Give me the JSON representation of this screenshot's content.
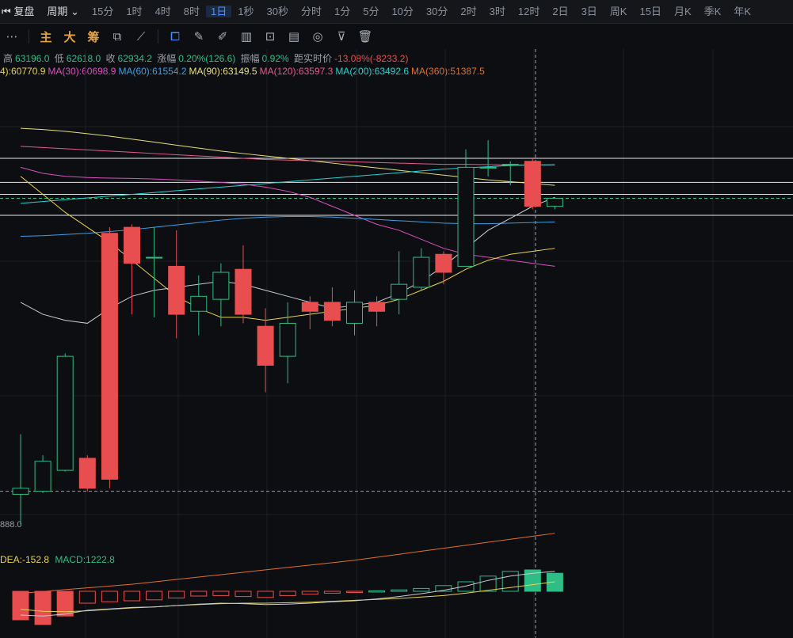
{
  "topbar": {
    "fq_label": "复盘",
    "zq_label": "周期",
    "periods": [
      "15分",
      "1时",
      "4时",
      "8时",
      "1日",
      "1秒",
      "30秒",
      "分时",
      "1分",
      "5分",
      "10分",
      "30分",
      "2时",
      "3时",
      "12时",
      "2日",
      "3日",
      "周K",
      "15日",
      "月K",
      "季K",
      "年K"
    ],
    "active_period": "1日"
  },
  "toolbar": {
    "indicators": [
      "主",
      "大",
      "筹"
    ]
  },
  "ohlc": {
    "high_label": "高",
    "high": "63196.0",
    "low_label": "低",
    "low": "62618.0",
    "close_label": "收",
    "close": "62934.2",
    "change_label": "涨幅",
    "change": "0.20%(126.6)",
    "amp_label": "振幅",
    "amp": "0.92%",
    "dist_label": "距实时价",
    "dist": "-13.08%(-8233.2)"
  },
  "ma": [
    {
      "text": "4):60770.9",
      "color": "#e8d44d"
    },
    {
      "text": "MA(30):60698.9",
      "color": "#d94fc0"
    },
    {
      "text": "MA(60):61554.2",
      "color": "#3aa0e8"
    },
    {
      "text": "MA(90):63149.5",
      "color": "#e8e07a"
    },
    {
      "text": "MA(120):63597.3",
      "color": "#e35d88"
    },
    {
      "text": "MA(200):63492.6",
      "color": "#27d1d1"
    },
    {
      "text": "MA(360):51387.5",
      "color": "#e0702a"
    }
  ],
  "macd": {
    "dea": "DEA:-152.8",
    "dea_color": "#e8d44d",
    "macd": "MACD:1222.8",
    "macd_color": "#2dbd85"
  },
  "price_label": "888.0",
  "colors": {
    "up": "#2dbd85",
    "down": "#e84e4f",
    "grid": "#1c1f24"
  },
  "chart_data": {
    "type": "candlestick",
    "candles": [
      {
        "o": 58000,
        "h": 59000,
        "l": 57500,
        "c": 58100
      },
      {
        "o": 58050,
        "h": 58650,
        "l": 58020,
        "c": 58550
      },
      {
        "o": 58400,
        "h": 60350,
        "l": 58380,
        "c": 60300
      },
      {
        "o": 58600,
        "h": 58650,
        "l": 58050,
        "c": 58100
      },
      {
        "o": 62350,
        "h": 62450,
        "l": 58100,
        "c": 58250
      },
      {
        "o": 62450,
        "h": 62500,
        "l": 61000,
        "c": 61850
      },
      {
        "o": 61950,
        "h": 62450,
        "l": 60950,
        "c": 61950
      },
      {
        "o": 61800,
        "h": 62400,
        "l": 60600,
        "c": 61000
      },
      {
        "o": 61050,
        "h": 61650,
        "l": 60650,
        "c": 61300
      },
      {
        "o": 61250,
        "h": 61850,
        "l": 60800,
        "c": 61700
      },
      {
        "o": 61750,
        "h": 62150,
        "l": 60850,
        "c": 61000
      },
      {
        "o": 60800,
        "h": 61100,
        "l": 59700,
        "c": 60150
      },
      {
        "o": 60300,
        "h": 61200,
        "l": 59850,
        "c": 60850
      },
      {
        "o": 61200,
        "h": 61300,
        "l": 60750,
        "c": 61050
      },
      {
        "o": 61200,
        "h": 61450,
        "l": 60800,
        "c": 60900
      },
      {
        "o": 60850,
        "h": 61400,
        "l": 60650,
        "c": 61200
      },
      {
        "o": 61200,
        "h": 61300,
        "l": 60800,
        "c": 61050
      },
      {
        "o": 61250,
        "h": 62050,
        "l": 61000,
        "c": 61500
      },
      {
        "o": 61450,
        "h": 62100,
        "l": 61400,
        "c": 61950
      },
      {
        "o": 62000,
        "h": 62050,
        "l": 61500,
        "c": 61700
      },
      {
        "o": 61800,
        "h": 63750,
        "l": 61800,
        "c": 63450
      },
      {
        "o": 63450,
        "h": 63900,
        "l": 63300,
        "c": 63450
      },
      {
        "o": 63500,
        "h": 63550,
        "l": 63150,
        "c": 63500
      },
      {
        "o": 63550,
        "h": 63600,
        "l": 62750,
        "c": 62800
      },
      {
        "o": 62800,
        "h": 62850,
        "l": 62750,
        "c": 62934.2
      }
    ],
    "ma_lines": [
      {
        "name": "MA(30)",
        "color": "#d94fc0",
        "values": [
          63450,
          63350,
          63300,
          63280,
          63270,
          63265,
          63255,
          63240,
          63220,
          63200,
          63170,
          63120,
          63050,
          62950,
          62800,
          62650,
          62500,
          62400,
          62250,
          62100,
          62000,
          61950,
          61900,
          61850,
          61800
        ]
      },
      {
        "name": "MA(60)",
        "color": "#3aa0e8",
        "values": [
          62300,
          62310,
          62330,
          62350,
          62380,
          62410,
          62450,
          62490,
          62530,
          62570,
          62600,
          62620,
          62630,
          62630,
          62620,
          62600,
          62580,
          62560,
          62540,
          62520,
          62510,
          62510,
          62520,
          62530,
          62540
        ]
      },
      {
        "name": "MA(90)",
        "color": "#e8e07a",
        "values": [
          64100,
          64080,
          64050,
          64010,
          63970,
          63920,
          63870,
          63820,
          63770,
          63720,
          63680,
          63640,
          63600,
          63560,
          63520,
          63480,
          63440,
          63400,
          63360,
          63320,
          63280,
          63240,
          63210,
          63180,
          63149.5
        ]
      },
      {
        "name": "MA(120)",
        "color": "#e35d88",
        "values": [
          63800,
          63780,
          63760,
          63740,
          63720,
          63700,
          63680,
          63660,
          63640,
          63620,
          63600,
          63580,
          63570,
          63560,
          63550,
          63540,
          63530,
          63520,
          63510,
          63500,
          63500,
          63495,
          63490,
          63490,
          63490
        ]
      },
      {
        "name": "MA(200)",
        "color": "#27d1d1",
        "values": [
          62850,
          62880,
          62910,
          62940,
          62970,
          63000,
          63030,
          63060,
          63090,
          63120,
          63150,
          63180,
          63210,
          63240,
          63270,
          63300,
          63330,
          63360,
          63390,
          63420,
          63440,
          63460,
          63480,
          63490,
          63492.6
        ]
      },
      {
        "name": "MA(360)",
        "color": "#e0702a",
        "values": [
          56350,
          56380,
          56410,
          56440,
          56470,
          56500,
          56540,
          56580,
          56620,
          56660,
          56700,
          56740,
          56780,
          56820,
          56860,
          56900,
          56950,
          57000,
          57050,
          57100,
          57150,
          57200,
          57250,
          57300,
          57350
        ]
      },
      {
        "name": "MA(short)",
        "color": "#e8d44d",
        "values": [
          63300,
          63000,
          62700,
          62450,
          62200,
          61900,
          61600,
          61300,
          61100,
          60950,
          60950,
          60900,
          60950,
          61000,
          61050,
          61100,
          61150,
          61250,
          61400,
          61550,
          61750,
          61900,
          62000,
          62050,
          62100
        ]
      },
      {
        "name": "MA(gray)",
        "color": "#c8ccd2",
        "values": [
          61200,
          61000,
          60900,
          60850,
          61100,
          61300,
          61400,
          61450,
          61500,
          61550,
          61500,
          61400,
          61300,
          61200,
          61100,
          61150,
          61200,
          61350,
          61550,
          61800,
          62100,
          62400,
          62600,
          62800,
          62950
        ]
      }
    ],
    "hlines": [
      63600,
      63200,
      63000,
      62650
    ],
    "dashed_price": 62934.2,
    "dashed_low": 58050,
    "macd_hist": [
      -600,
      -700,
      -520,
      -250,
      -220,
      -200,
      -180,
      -140,
      -100,
      -90,
      -110,
      -130,
      -90,
      -60,
      -40,
      -20,
      10,
      30,
      60,
      120,
      200,
      320,
      420,
      450,
      380
    ],
    "dea_line": [
      -380,
      -420,
      -430,
      -410,
      -380,
      -350,
      -330,
      -300,
      -280,
      -260,
      -250,
      -250,
      -240,
      -230,
      -210,
      -190,
      -170,
      -150,
      -120,
      -90,
      -40,
      20,
      80,
      140,
      200
    ],
    "macd_line": [
      -500,
      -520,
      -480,
      -400,
      -370,
      -340,
      -330,
      -300,
      -270,
      -250,
      -260,
      -280,
      -270,
      -250,
      -220,
      -200,
      -160,
      -110,
      -50,
      20,
      110,
      230,
      320,
      380,
      420
    ]
  }
}
